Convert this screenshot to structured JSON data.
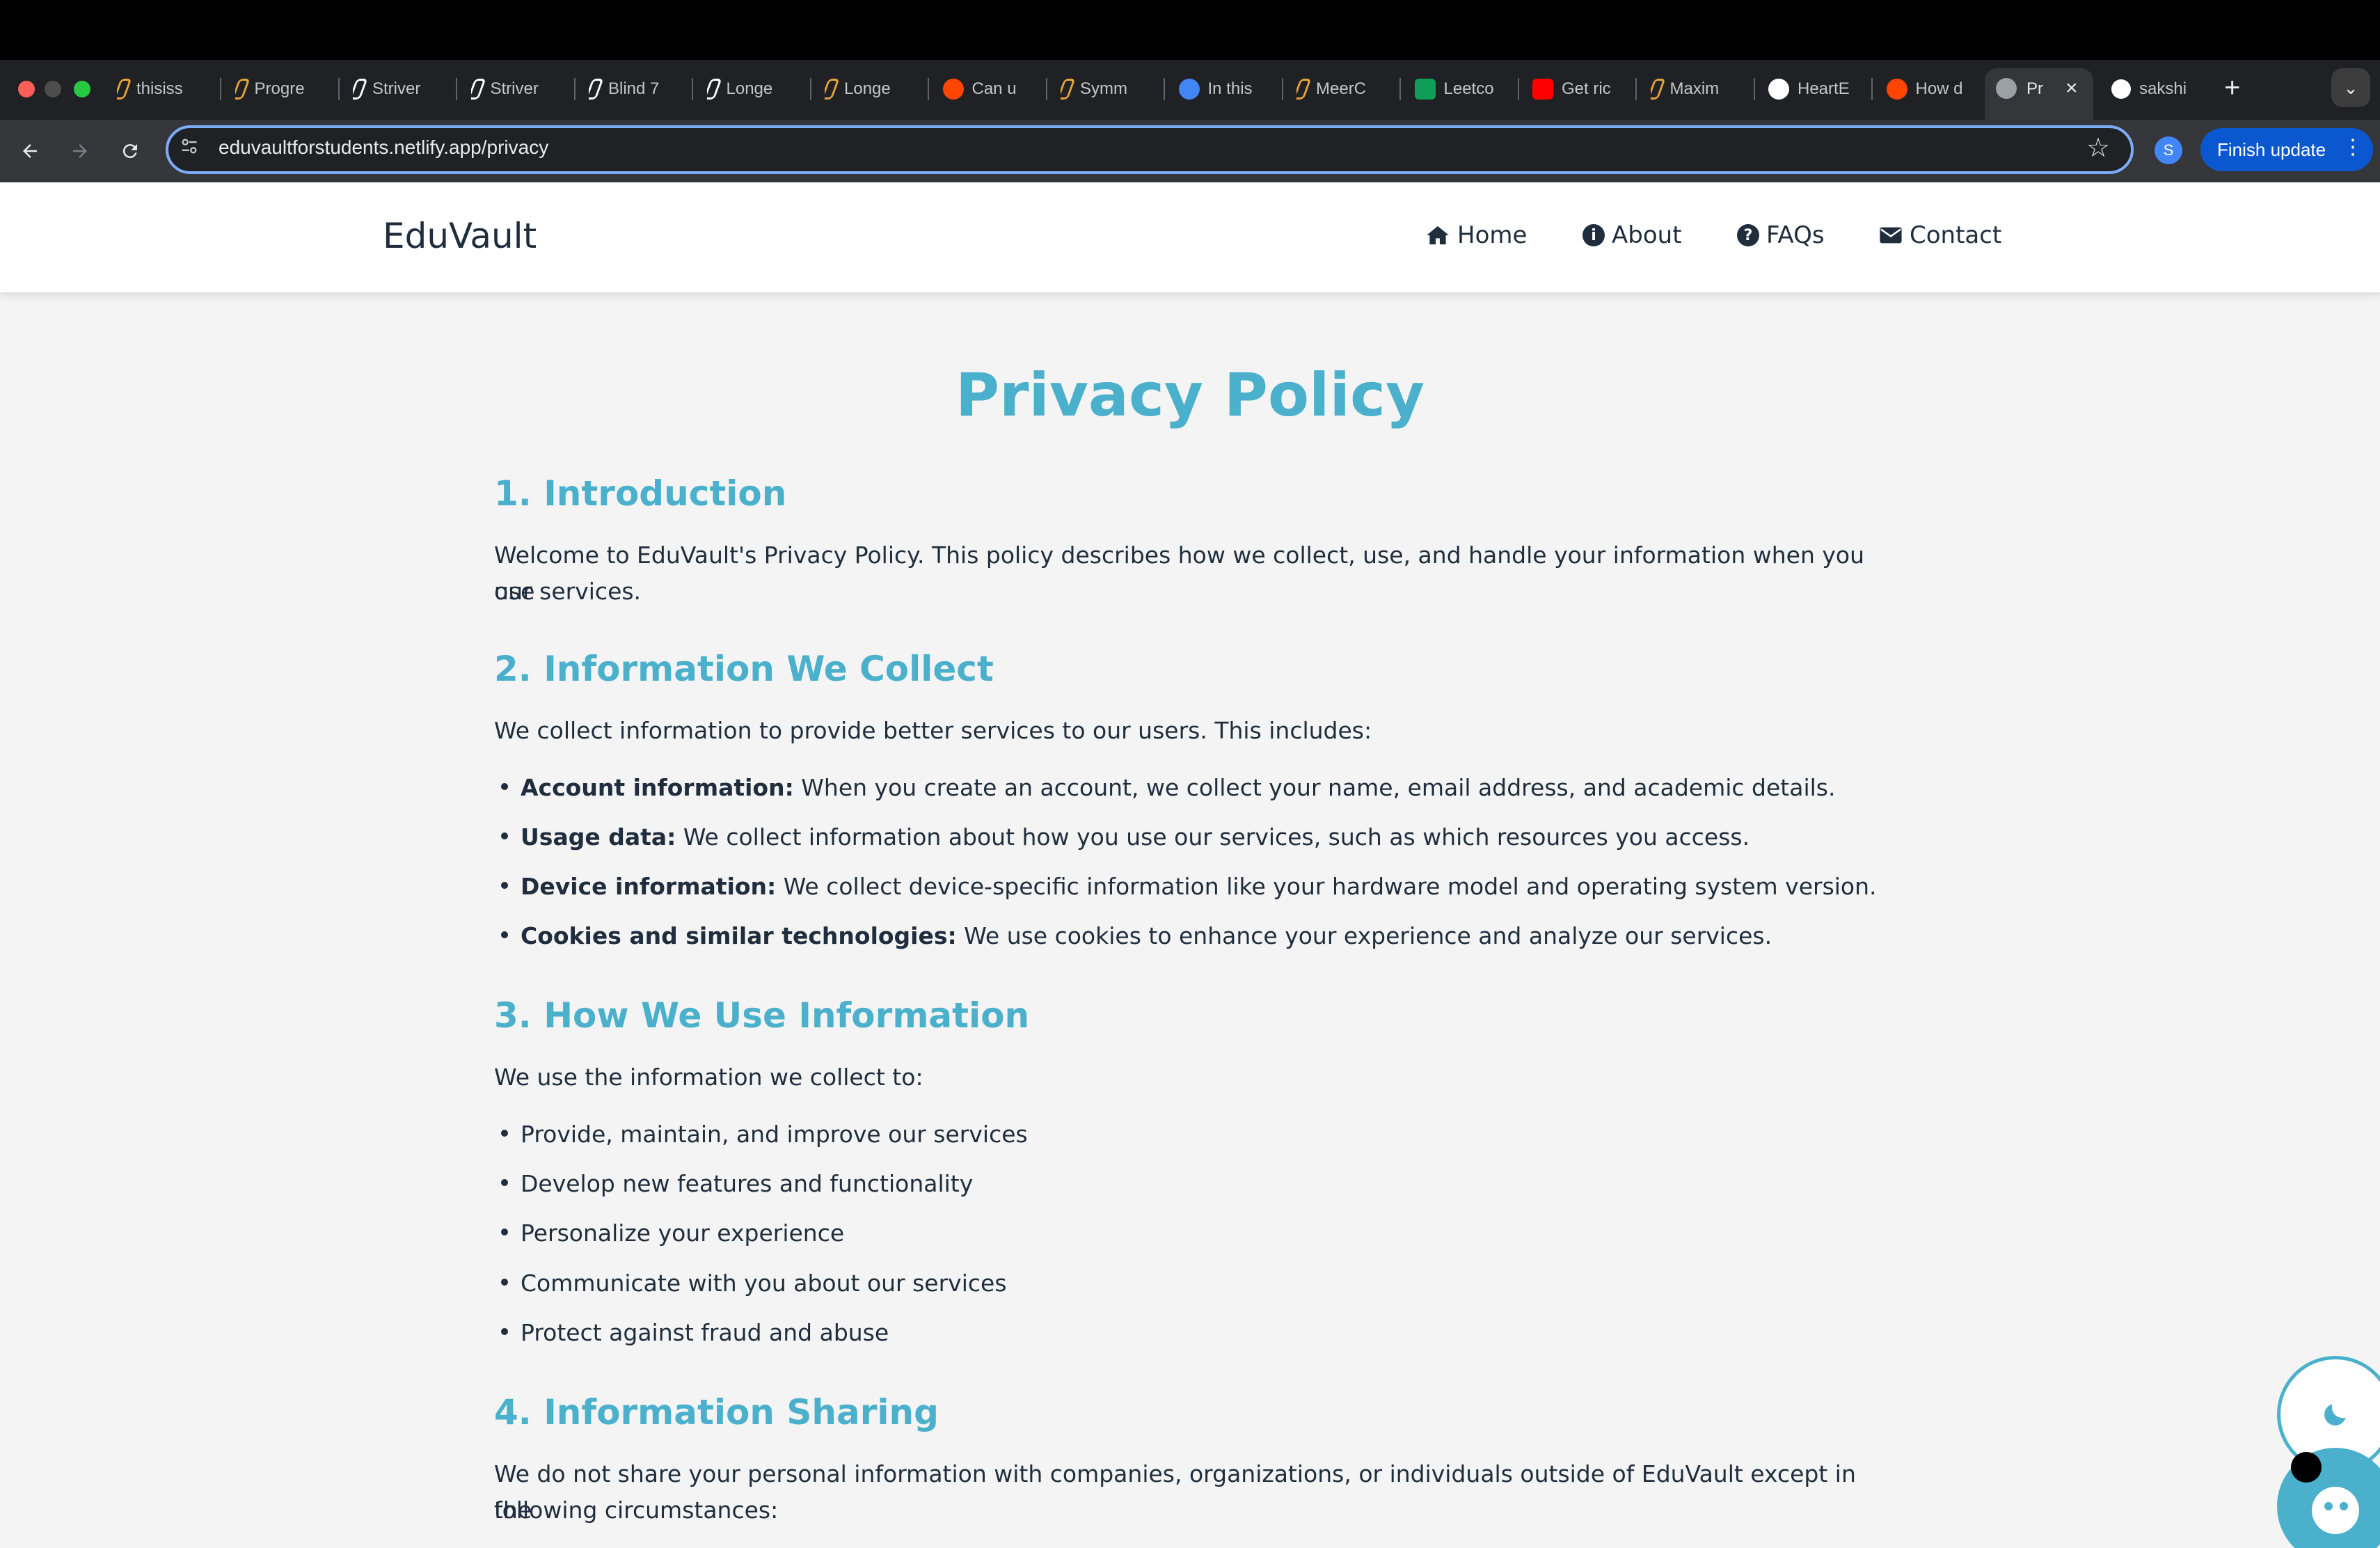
{
  "browser": {
    "tabs": [
      {
        "label": "thisiss",
        "icon": "striver-icon",
        "color": "#e8a33d"
      },
      {
        "label": "Progre",
        "icon": "striver-icon",
        "color": "#e8a33d"
      },
      {
        "label": "Striver",
        "icon": "tuf-icon",
        "color": "#ffffff"
      },
      {
        "label": "Striver",
        "icon": "tuf-icon",
        "color": "#ffffff"
      },
      {
        "label": "Blind 7",
        "icon": "rocket-icon",
        "color": "#ffffff"
      },
      {
        "label": "Longe",
        "icon": "tuf-icon",
        "color": "#ffffff"
      },
      {
        "label": "Longe",
        "icon": "striver-icon",
        "color": "#e8a33d"
      },
      {
        "label": "Can u",
        "icon": "reddit-icon",
        "color": "#ff4500"
      },
      {
        "label": "Symm",
        "icon": "striver-icon",
        "color": "#e8a33d"
      },
      {
        "label": "In this",
        "icon": "google-icon",
        "color": "#4285f4"
      },
      {
        "label": "MeerC",
        "icon": "meer-icon",
        "color": "#e8a33d"
      },
      {
        "label": "Leetco",
        "icon": "sheets-icon",
        "color": "#0f9d58"
      },
      {
        "label": "Get ric",
        "icon": "youtube-icon",
        "color": "#ff0000"
      },
      {
        "label": "Maxim",
        "icon": "striver-icon",
        "color": "#e8a33d"
      },
      {
        "label": "HeartE",
        "icon": "github-icon",
        "color": "#ffffff"
      },
      {
        "label": "How d",
        "icon": "reddit-icon",
        "color": "#ff4500"
      }
    ],
    "active_tab": {
      "label": "Pr",
      "icon": "globe-icon"
    },
    "last_tab": {
      "label": "sakshi",
      "icon": "github-icon"
    },
    "url": "eduvaultforstudents.netlify.app/privacy",
    "profile_initial": "S",
    "finish_update": "Finish update"
  },
  "site": {
    "brand": "EduVault",
    "nav": [
      {
        "label": "Home",
        "icon": "home-icon"
      },
      {
        "label": "About",
        "icon": "info-icon"
      },
      {
        "label": "FAQs",
        "icon": "question-icon"
      },
      {
        "label": "Contact",
        "icon": "envelope-icon"
      }
    ]
  },
  "policy": {
    "title": "Privacy Policy",
    "s1": {
      "heading": "1. Introduction",
      "text_line1": "Welcome to EduVault's Privacy Policy. This policy describes how we collect, use, and handle your information when you use",
      "text_line2": "our services."
    },
    "s2": {
      "heading": "2. Information We Collect",
      "intro": "We collect information to provide better services to our users. This includes:",
      "items": [
        {
          "term": "Account information:",
          "desc": " When you create an account, we collect your name, email address, and academic details."
        },
        {
          "term": "Usage data:",
          "desc": " We collect information about how you use our services, such as which resources you access."
        },
        {
          "term": "Device information:",
          "desc": " We collect device-specific information like your hardware model and operating system version."
        },
        {
          "term": "Cookies and similar technologies:",
          "desc": " We use cookies to enhance your experience and analyze our services."
        }
      ]
    },
    "s3": {
      "heading": "3. How We Use Information",
      "intro": "We use the information we collect to:",
      "items": [
        "Provide, maintain, and improve our services",
        "Develop new features and functionality",
        "Personalize your experience",
        "Communicate with you about our services",
        "Protect against fraud and abuse"
      ]
    },
    "s4": {
      "heading": "4. Information Sharing",
      "text_line1": "We do not share your personal information with companies, organizations, or individuals outside of EduVault except in the",
      "text_line2": "following circumstances:"
    }
  },
  "colors": {
    "accent": "#4ab0cb",
    "text": "#1f2d3d",
    "page_bg": "#f4f4f4"
  }
}
